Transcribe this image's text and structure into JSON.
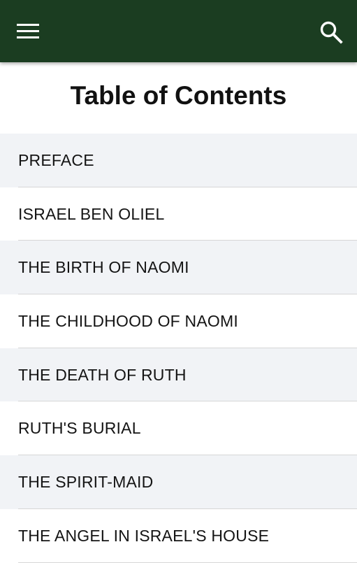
{
  "app_bar": {
    "background_color": "#1b3d21",
    "menu_icon": "hamburger-menu-icon",
    "search_icon": "search-icon"
  },
  "page": {
    "title": "Table of Contents"
  },
  "toc": {
    "items": [
      {
        "label": "PREFACE"
      },
      {
        "label": "ISRAEL BEN OLIEL"
      },
      {
        "label": "THE BIRTH OF NAOMI"
      },
      {
        "label": "THE CHILDHOOD OF NAOMI"
      },
      {
        "label": "THE DEATH OF RUTH"
      },
      {
        "label": "RUTH'S BURIAL"
      },
      {
        "label": "THE SPIRIT-MAID"
      },
      {
        "label": "THE ANGEL IN ISRAEL'S HOUSE"
      }
    ]
  }
}
